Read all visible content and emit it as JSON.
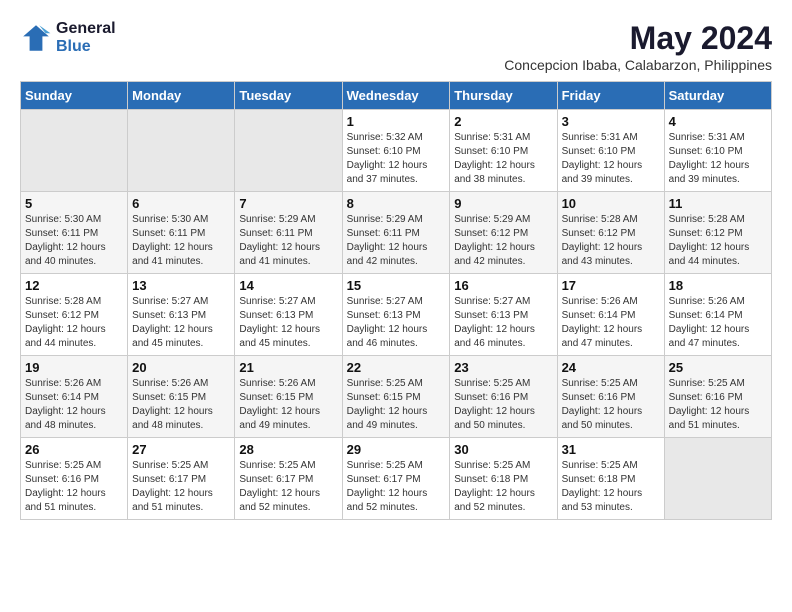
{
  "logo": {
    "line1": "General",
    "line2": "Blue"
  },
  "title": "May 2024",
  "location": "Concepcion Ibaba, Calabarzon, Philippines",
  "days_of_week": [
    "Sunday",
    "Monday",
    "Tuesday",
    "Wednesday",
    "Thursday",
    "Friday",
    "Saturday"
  ],
  "weeks": [
    [
      {
        "day": "",
        "info": ""
      },
      {
        "day": "",
        "info": ""
      },
      {
        "day": "",
        "info": ""
      },
      {
        "day": "1",
        "info": "Sunrise: 5:32 AM\nSunset: 6:10 PM\nDaylight: 12 hours\nand 37 minutes."
      },
      {
        "day": "2",
        "info": "Sunrise: 5:31 AM\nSunset: 6:10 PM\nDaylight: 12 hours\nand 38 minutes."
      },
      {
        "day": "3",
        "info": "Sunrise: 5:31 AM\nSunset: 6:10 PM\nDaylight: 12 hours\nand 39 minutes."
      },
      {
        "day": "4",
        "info": "Sunrise: 5:31 AM\nSunset: 6:10 PM\nDaylight: 12 hours\nand 39 minutes."
      }
    ],
    [
      {
        "day": "5",
        "info": "Sunrise: 5:30 AM\nSunset: 6:11 PM\nDaylight: 12 hours\nand 40 minutes."
      },
      {
        "day": "6",
        "info": "Sunrise: 5:30 AM\nSunset: 6:11 PM\nDaylight: 12 hours\nand 41 minutes."
      },
      {
        "day": "7",
        "info": "Sunrise: 5:29 AM\nSunset: 6:11 PM\nDaylight: 12 hours\nand 41 minutes."
      },
      {
        "day": "8",
        "info": "Sunrise: 5:29 AM\nSunset: 6:11 PM\nDaylight: 12 hours\nand 42 minutes."
      },
      {
        "day": "9",
        "info": "Sunrise: 5:29 AM\nSunset: 6:12 PM\nDaylight: 12 hours\nand 42 minutes."
      },
      {
        "day": "10",
        "info": "Sunrise: 5:28 AM\nSunset: 6:12 PM\nDaylight: 12 hours\nand 43 minutes."
      },
      {
        "day": "11",
        "info": "Sunrise: 5:28 AM\nSunset: 6:12 PM\nDaylight: 12 hours\nand 44 minutes."
      }
    ],
    [
      {
        "day": "12",
        "info": "Sunrise: 5:28 AM\nSunset: 6:12 PM\nDaylight: 12 hours\nand 44 minutes."
      },
      {
        "day": "13",
        "info": "Sunrise: 5:27 AM\nSunset: 6:13 PM\nDaylight: 12 hours\nand 45 minutes."
      },
      {
        "day": "14",
        "info": "Sunrise: 5:27 AM\nSunset: 6:13 PM\nDaylight: 12 hours\nand 45 minutes."
      },
      {
        "day": "15",
        "info": "Sunrise: 5:27 AM\nSunset: 6:13 PM\nDaylight: 12 hours\nand 46 minutes."
      },
      {
        "day": "16",
        "info": "Sunrise: 5:27 AM\nSunset: 6:13 PM\nDaylight: 12 hours\nand 46 minutes."
      },
      {
        "day": "17",
        "info": "Sunrise: 5:26 AM\nSunset: 6:14 PM\nDaylight: 12 hours\nand 47 minutes."
      },
      {
        "day": "18",
        "info": "Sunrise: 5:26 AM\nSunset: 6:14 PM\nDaylight: 12 hours\nand 47 minutes."
      }
    ],
    [
      {
        "day": "19",
        "info": "Sunrise: 5:26 AM\nSunset: 6:14 PM\nDaylight: 12 hours\nand 48 minutes."
      },
      {
        "day": "20",
        "info": "Sunrise: 5:26 AM\nSunset: 6:15 PM\nDaylight: 12 hours\nand 48 minutes."
      },
      {
        "day": "21",
        "info": "Sunrise: 5:26 AM\nSunset: 6:15 PM\nDaylight: 12 hours\nand 49 minutes."
      },
      {
        "day": "22",
        "info": "Sunrise: 5:25 AM\nSunset: 6:15 PM\nDaylight: 12 hours\nand 49 minutes."
      },
      {
        "day": "23",
        "info": "Sunrise: 5:25 AM\nSunset: 6:16 PM\nDaylight: 12 hours\nand 50 minutes."
      },
      {
        "day": "24",
        "info": "Sunrise: 5:25 AM\nSunset: 6:16 PM\nDaylight: 12 hours\nand 50 minutes."
      },
      {
        "day": "25",
        "info": "Sunrise: 5:25 AM\nSunset: 6:16 PM\nDaylight: 12 hours\nand 51 minutes."
      }
    ],
    [
      {
        "day": "26",
        "info": "Sunrise: 5:25 AM\nSunset: 6:16 PM\nDaylight: 12 hours\nand 51 minutes."
      },
      {
        "day": "27",
        "info": "Sunrise: 5:25 AM\nSunset: 6:17 PM\nDaylight: 12 hours\nand 51 minutes."
      },
      {
        "day": "28",
        "info": "Sunrise: 5:25 AM\nSunset: 6:17 PM\nDaylight: 12 hours\nand 52 minutes."
      },
      {
        "day": "29",
        "info": "Sunrise: 5:25 AM\nSunset: 6:17 PM\nDaylight: 12 hours\nand 52 minutes."
      },
      {
        "day": "30",
        "info": "Sunrise: 5:25 AM\nSunset: 6:18 PM\nDaylight: 12 hours\nand 52 minutes."
      },
      {
        "day": "31",
        "info": "Sunrise: 5:25 AM\nSunset: 6:18 PM\nDaylight: 12 hours\nand 53 minutes."
      },
      {
        "day": "",
        "info": ""
      }
    ]
  ]
}
